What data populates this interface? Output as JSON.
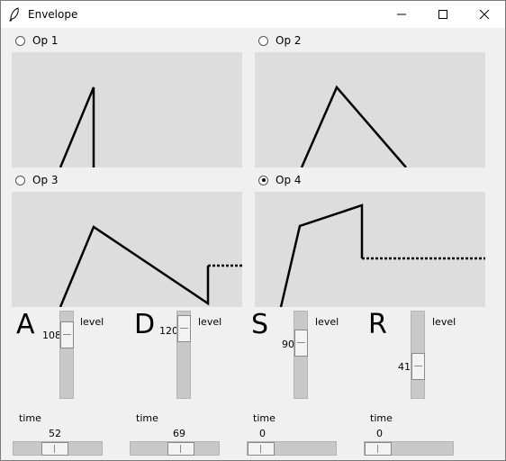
{
  "window": {
    "title": "Envelope"
  },
  "ops": [
    {
      "label": "Op 1",
      "selected": false
    },
    {
      "label": "Op 2",
      "selected": false
    },
    {
      "label": "Op 3",
      "selected": false
    },
    {
      "label": "Op 4",
      "selected": true
    }
  ],
  "controls": [
    {
      "letter": "A",
      "level_label": "level",
      "level_value": "108",
      "level_fraction": 0.16,
      "time_label": "time",
      "time_value": "52",
      "time_fraction": 0.45
    },
    {
      "letter": "D",
      "level_label": "level",
      "level_value": "120",
      "level_fraction": 0.06,
      "time_label": "time",
      "time_value": "69",
      "time_fraction": 0.6
    },
    {
      "letter": "S",
      "level_label": "level",
      "level_value": "90",
      "level_fraction": 0.3,
      "time_label": "time",
      "time_value": "0",
      "time_fraction": 0.0
    },
    {
      "letter": "R",
      "level_label": "level",
      "level_value": "41",
      "level_fraction": 0.7,
      "time_label": "time",
      "time_value": "0",
      "time_fraction": 0.0
    }
  ]
}
